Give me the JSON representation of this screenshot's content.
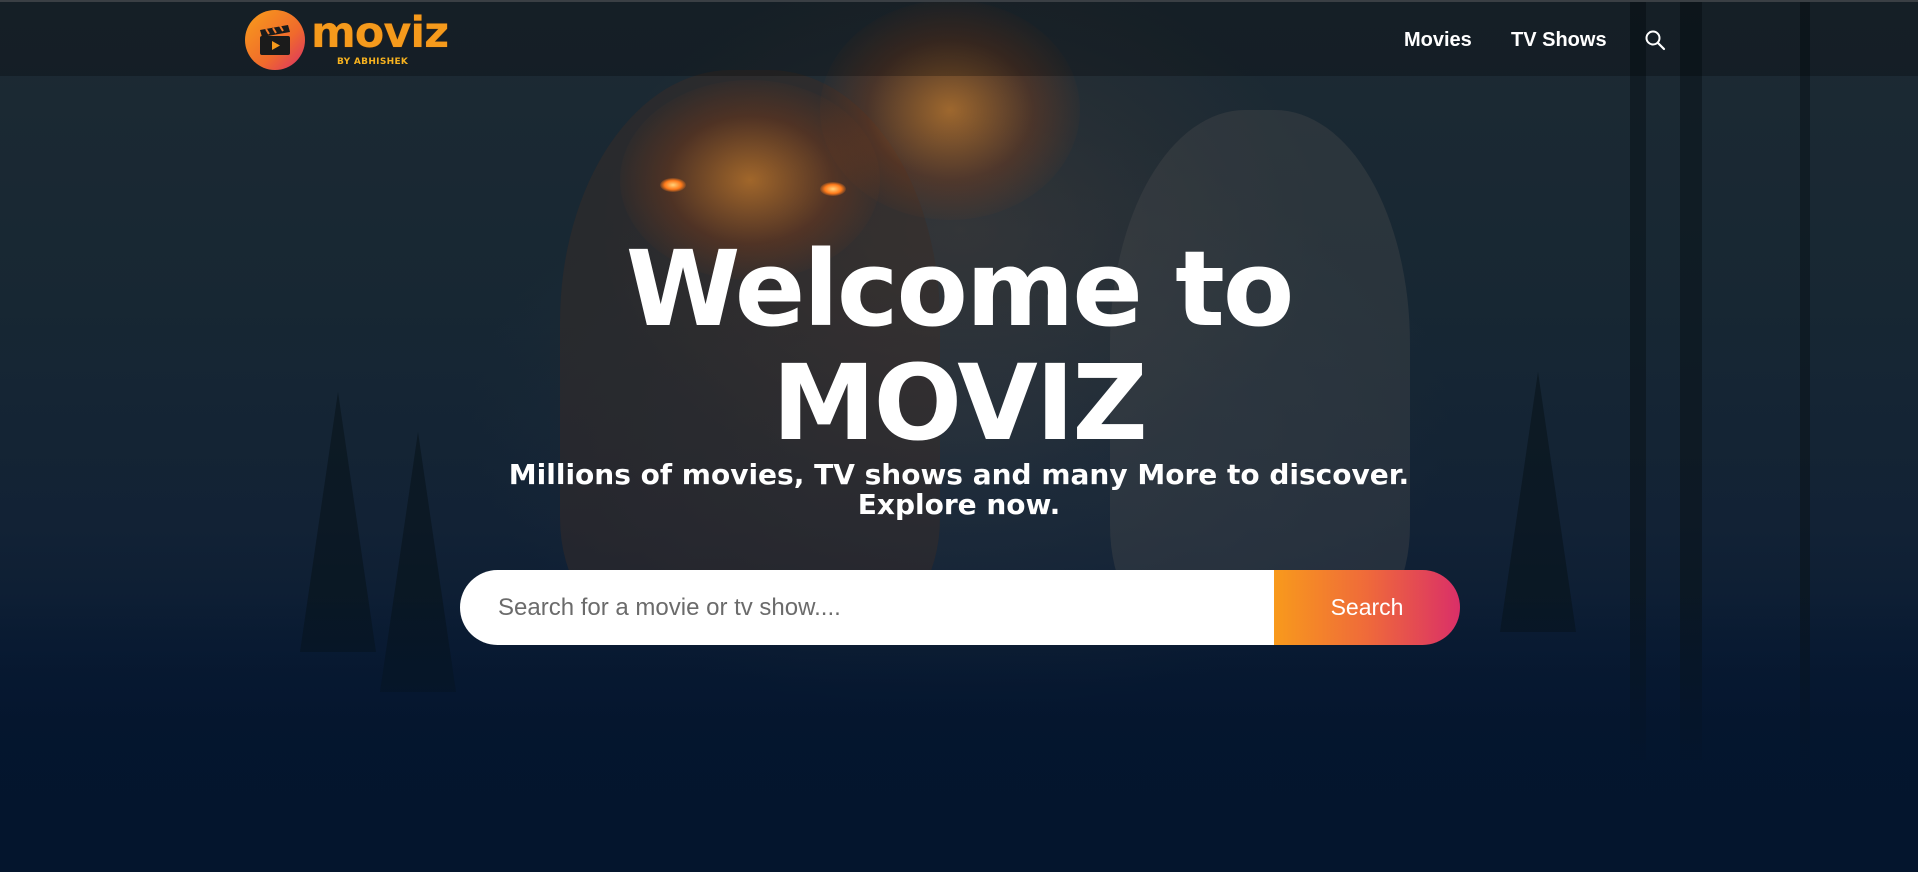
{
  "header": {
    "logo": {
      "word": "moviz",
      "tagline": "BY ABHISHEK"
    },
    "nav": [
      {
        "label": "Movies"
      },
      {
        "label": "TV Shows"
      }
    ]
  },
  "hero": {
    "title_line1": "Welcome to",
    "title_line2": "MOVIZ",
    "subtitle": "Millions of movies, TV shows and many More to discover. Explore now.",
    "search": {
      "placeholder": "Search for a movie or tv show....",
      "button_label": "Search"
    }
  },
  "colors": {
    "accent_start": "#f89a1c",
    "accent_end": "#da2f68",
    "background": "#04152d"
  }
}
